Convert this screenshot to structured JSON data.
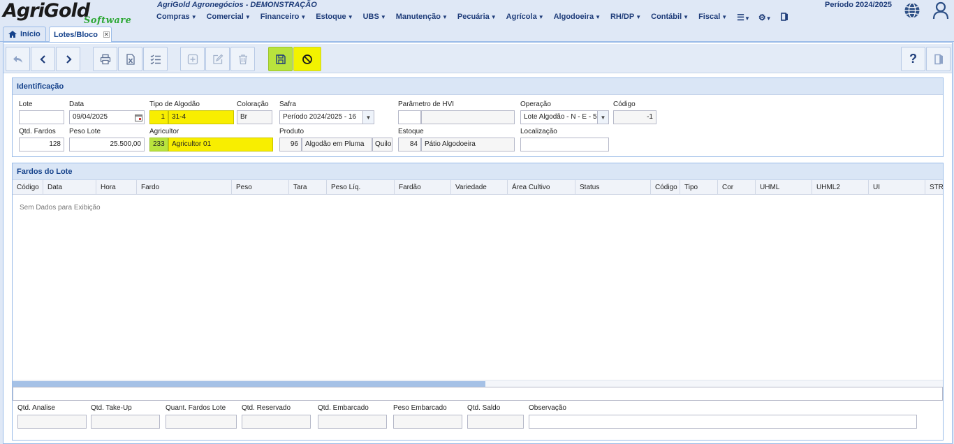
{
  "header": {
    "logo_main": "AgriGold",
    "logo_sub": "Software",
    "company": "AgriGold Agronegócios - DEMONSTRAÇÃO",
    "periodo": "Período 2024/2025",
    "menu": [
      "Compras",
      "Comercial",
      "Financeiro",
      "Estoque",
      "UBS",
      "Manutenção",
      "Pecuária",
      "Agrícola",
      "Algodoeira",
      "RH/DP",
      "Contábil",
      "Fiscal"
    ],
    "menu_icons": [
      "list-icon",
      "gears-icon",
      "exit-icon"
    ]
  },
  "tabs": [
    {
      "label": "Início",
      "icon": "home-icon"
    },
    {
      "label": "Lotes/Bloco",
      "closable": true
    }
  ],
  "toolbar": {
    "buttons": [
      "undo",
      "previous",
      "next",
      "print",
      "export-excel",
      "checklist",
      "add",
      "edit",
      "delete",
      "save",
      "cancel"
    ],
    "right_buttons": [
      "help",
      "exit"
    ]
  },
  "identificacao": {
    "title": "Identificação",
    "lote": {
      "label": "Lote",
      "value": ""
    },
    "data": {
      "label": "Data",
      "value": "09/04/2025"
    },
    "tipo_algodao": {
      "label": "Tipo de Algodão",
      "code": "1",
      "value": "31-4"
    },
    "coloracao": {
      "label": "Coloração",
      "value": "Br"
    },
    "safra": {
      "label": "Safra",
      "value": "Período 2024/2025 - 16"
    },
    "parametro_hvi": {
      "label": "Parâmetro de HVI",
      "code": "",
      "value": ""
    },
    "operacao": {
      "label": "Operação",
      "value": "Lote Algodão - N - E - 5"
    },
    "codigo": {
      "label": "Código",
      "value": "-1"
    },
    "qtd_fardos": {
      "label": "Qtd. Fardos",
      "value": "128"
    },
    "peso_lote": {
      "label": "Peso Lote",
      "value": "25.500,00"
    },
    "agricultor": {
      "label": "Agricultor",
      "code": "233",
      "value": "Agricultor 01"
    },
    "produto": {
      "label": "Produto",
      "code": "96",
      "value": "Algodão em Pluma",
      "unit": "Quilo"
    },
    "estoque": {
      "label": "Estoque",
      "code": "84",
      "value": "Pátio Algodoeira"
    },
    "localizacao": {
      "label": "Localização",
      "value": ""
    }
  },
  "fardos": {
    "title": "Fardos do Lote",
    "columns": [
      "Código",
      "Data",
      "Hora",
      "Fardo",
      "Peso",
      "Tara",
      "Peso Líq.",
      "Fardão",
      "Variedade",
      "Área Cultivo",
      "Status",
      "Código",
      "Tipo",
      "Cor",
      "UHML",
      "UHML2",
      "UI",
      "STR"
    ],
    "empty_text": "Sem Dados para Exibição",
    "summary": [
      {
        "label": "Qtd. Analise",
        "value": ""
      },
      {
        "label": "Qtd. Take-Up",
        "value": ""
      },
      {
        "label": "Quant. Fardos Lote",
        "value": ""
      },
      {
        "label": "Qtd. Reservado",
        "value": ""
      },
      {
        "label": "Qtd. Embarcado",
        "value": ""
      },
      {
        "label": "Peso Embarcado",
        "value": ""
      },
      {
        "label": "Qtd. Saldo",
        "value": ""
      },
      {
        "label": "Observação",
        "value": ""
      }
    ]
  }
}
